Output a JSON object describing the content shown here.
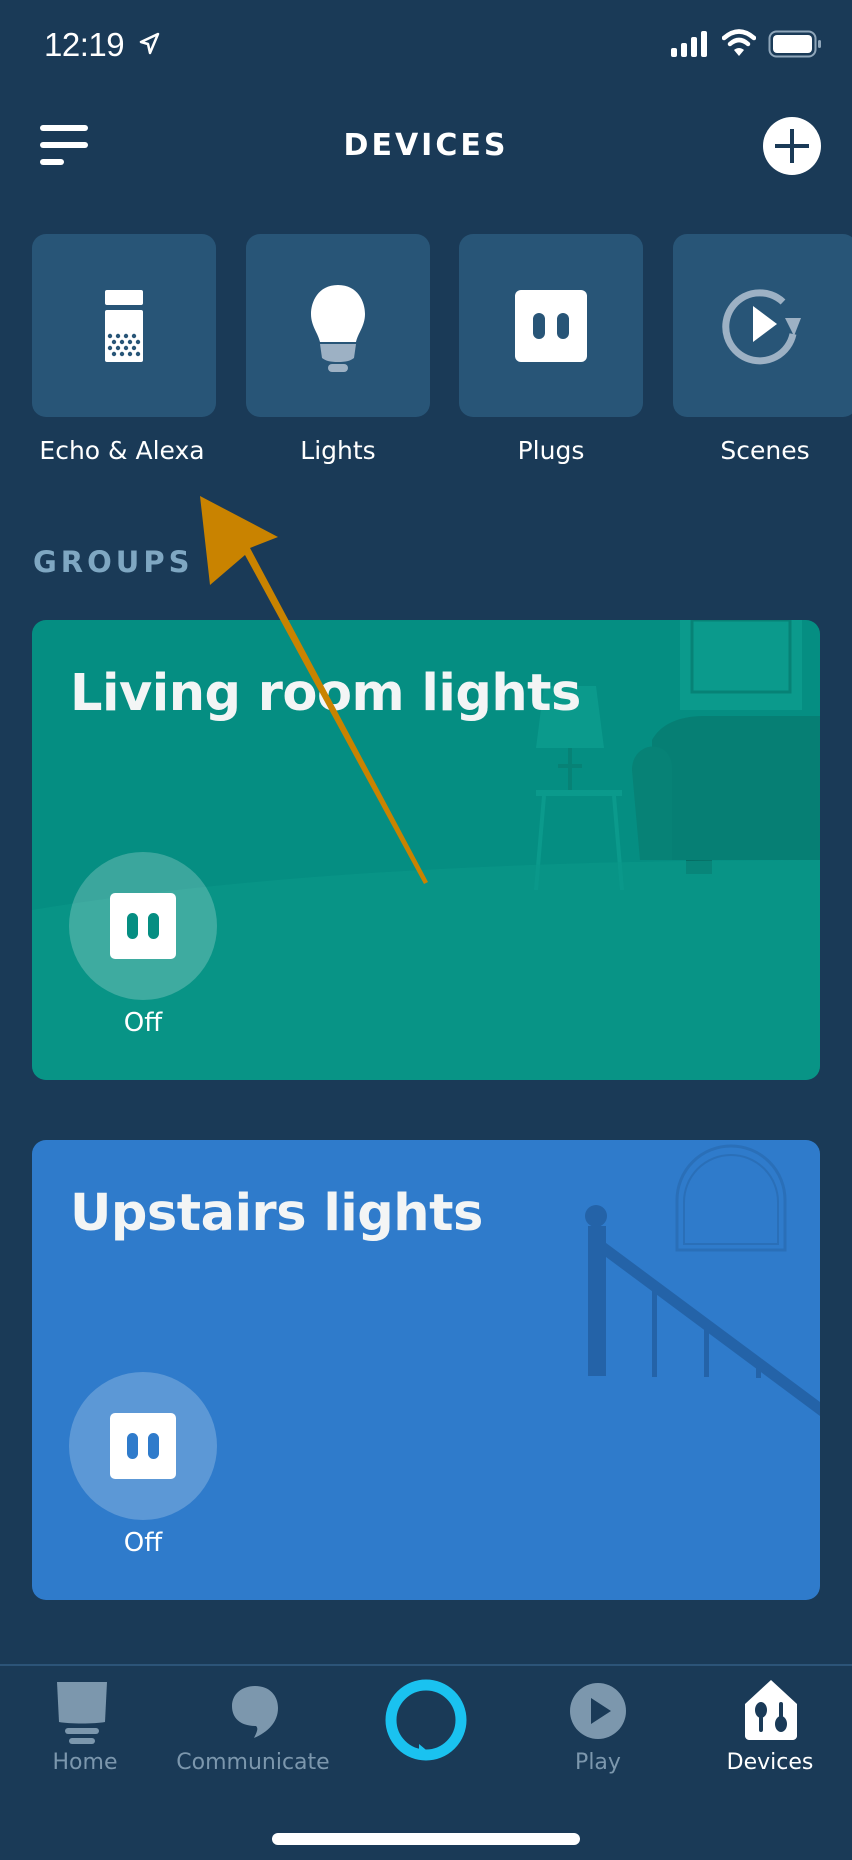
{
  "status_bar": {
    "time": "12:19",
    "icons": [
      "location-arrow-icon",
      "cellular-signal-icon",
      "wifi-icon",
      "battery-icon"
    ]
  },
  "header": {
    "title": "DEVICES",
    "menu_icon": "hamburger-menu-icon",
    "add_icon": "plus-circle-icon"
  },
  "categories": [
    {
      "label": "Echo & Alexa",
      "icon": "echo-speaker-icon"
    },
    {
      "label": "Lights",
      "icon": "light-bulb-icon"
    },
    {
      "label": "Plugs",
      "icon": "plug-icon"
    },
    {
      "label": "Scenes",
      "icon": "scenes-play-icon"
    }
  ],
  "groups": {
    "heading": "GROUPS",
    "items": [
      {
        "title": "Living room lights",
        "state": "Off",
        "color": "#058e82",
        "icon": "plug-icon"
      },
      {
        "title": "Upstairs lights",
        "state": "Off",
        "color": "#2f7bcb",
        "icon": "plug-icon"
      }
    ]
  },
  "bottom_nav": {
    "items": [
      {
        "label": "Home",
        "icon": "home-icon",
        "active": false
      },
      {
        "label": "Communicate",
        "icon": "speech-bubble-icon",
        "active": false
      },
      {
        "label": "",
        "icon": "alexa-ring-icon",
        "active": false
      },
      {
        "label": "Play",
        "icon": "play-icon",
        "active": false
      },
      {
        "label": "Devices",
        "icon": "devices-house-icon",
        "active": true
      }
    ]
  },
  "colors": {
    "background": "#1a3a57",
    "tile": "#285577",
    "alexa_accent": "#1ac2f0",
    "annotation_arrow": "#c98300",
    "inactive_nav": "#7c97ad"
  }
}
